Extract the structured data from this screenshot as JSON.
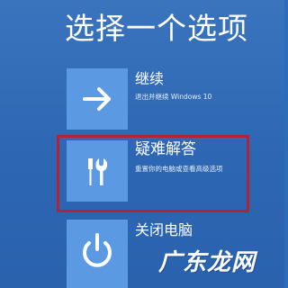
{
  "screen": {
    "title": "选择一个选项"
  },
  "options": [
    {
      "label": "继续",
      "description": "退出并继续 Windows 10",
      "icon": "arrow-right-icon"
    },
    {
      "label": "疑难解答",
      "description": "重置你的电脑或查看高级选项",
      "icon": "tools-icon"
    },
    {
      "label": "关闭电脑",
      "description": "",
      "icon": "power-icon"
    }
  ],
  "watermark": {
    "text": "广东龙网"
  },
  "colors": {
    "background": "#2e6bb8",
    "tile": "#5b9ae3",
    "highlight": "#b0243a",
    "text": "#ffffff"
  }
}
